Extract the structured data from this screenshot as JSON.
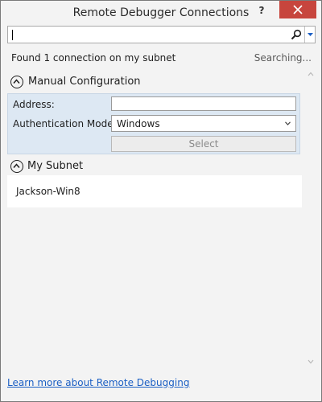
{
  "window": {
    "title": "Remote Debugger Connections",
    "help_label": "?"
  },
  "search": {
    "value": "",
    "placeholder": ""
  },
  "status": {
    "found_text": "Found 1 connection on my subnet",
    "searching_text": "Searching..."
  },
  "manual": {
    "section_label": "Manual Configuration",
    "address_label": "Address:",
    "address_value": "",
    "auth_label": "Authentication Mode:",
    "auth_value": "Windows",
    "select_label": "Select"
  },
  "subnet": {
    "section_label": "My Subnet",
    "items": [
      {
        "name": "Jackson-Win8"
      }
    ]
  },
  "footer": {
    "link_text": "Learn more about Remote Debugging"
  },
  "colors": {
    "close_button": "#c7453d",
    "panel_background": "#dde8f3",
    "link": "#1b5fc4"
  }
}
